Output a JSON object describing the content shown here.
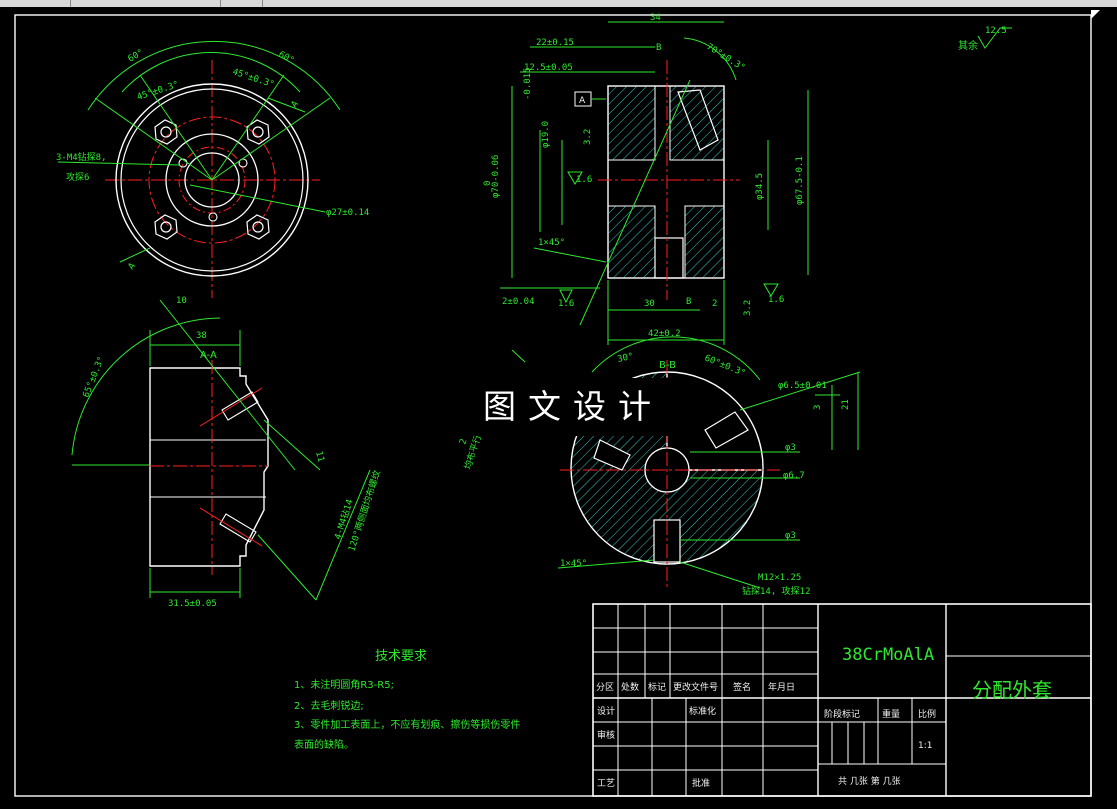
{
  "drawing": {
    "roughness_symbol": "12.5",
    "roughness_note": "其余",
    "section_aa_label": "A-A",
    "section_bb_label": "B-B",
    "datum_label": "A"
  },
  "top_left_view": {
    "angle_60_left": "60°",
    "angle_60_right": "60°",
    "angle_45_left": "45°±0.3°",
    "angle_45_right": "45°±0.3°",
    "hole_note_1": "3-M4钻探8,",
    "hole_note_2": "攻探6",
    "dia_27": "φ27±0.14",
    "cut_a_top": "A",
    "cut_a_bottom": "A"
  },
  "bottom_left_view": {
    "dim_10": "10",
    "dim_38": "38",
    "angle_65": "65°±0.3°",
    "dim_11": "11",
    "thread_note_1": "4-M4钻14",
    "thread_note_2": "120°两侧面均布螺纹",
    "dim_31_5": "31.5±0.05"
  },
  "top_right_view": {
    "dim_34": "34",
    "dim_22": "22±0.15",
    "dim_12_5": "12.5±0.05",
    "angle_70": "70°±0.3°",
    "b_top": "B",
    "b_bottom": "B",
    "tol_minus": "-0.015",
    "dia_19": "φ19.0",
    "r32_left": "3.2",
    "r16_left": "1.6",
    "dia_70": "φ70-0.06",
    "tol_zero": "0",
    "chamfer_1x45": "1×45°",
    "dia_34_5": "φ34.5",
    "dia_67_5": "φ67.5-0.1",
    "r16_bottom_left": "1.6",
    "dim_2_004": "2±0.04",
    "dim_30": "30",
    "dim_2": "2",
    "r32_right": "3.2",
    "r16_right": "1.6",
    "dim_42": "42±0.2"
  },
  "bottom_right_view": {
    "angle_30": "30°",
    "angle_60": "60°±0.3°",
    "dia_6_5": "φ6.5±0.01",
    "dim_3": "3",
    "dim_21": "21",
    "dim_2_side": "2",
    "side_note": "均布平行",
    "dia_3_top": "φ3",
    "dia_6_7": "φ6.7",
    "dia_3_bottom": "φ3",
    "chamfer": "1×45°",
    "thread_1": "M12×1.25",
    "thread_2": "钻探14, 攻探12"
  },
  "watermark": "图文设计",
  "tech_requirements": {
    "title": "技术要求",
    "items": [
      "1、未注明圆角R3-R5;",
      "2、去毛刺锐边;",
      "3、零件加工表面上，不应有划痕、擦伤等损伤零件"
    ],
    "item3_cont": "表面的缺陷。"
  },
  "title_block": {
    "material": "38CrMoAlA",
    "part_name": "分配外套",
    "headers": [
      "分区",
      "处数",
      "标记",
      "更改文件号",
      "签名",
      "年月日"
    ],
    "design": "设计",
    "standardize": "标准化",
    "stage_mark": "阶段标记",
    "weight": "重量",
    "scale": "比例",
    "review": "审核",
    "scale_value": "1:1",
    "process": "工艺",
    "approve": "批准",
    "sheets": "共  几张  第  几张"
  },
  "colors": {
    "background": "#000000",
    "outline": "#ffffff",
    "dimension": "#2ee82e",
    "centerline": "#ff2020",
    "hatch": "#39c6c6"
  }
}
